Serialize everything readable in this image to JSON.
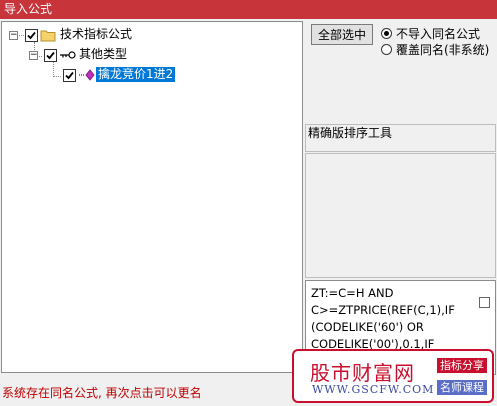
{
  "window": {
    "title": "导入公式"
  },
  "tree": {
    "root_label": "技术指标公式",
    "group_label": "其他类型",
    "item_label": "擒龙竞价1进2"
  },
  "options": {
    "select_all_label": "全部选中",
    "radio_skip_label": "不导入同名公式",
    "radio_overwrite_label": "覆盖同名(非系统)"
  },
  "description": {
    "title": "精确版排序工具"
  },
  "code": {
    "lines": [
      "ZT:=C=H AND",
      "C>=ZTPRICE(REF(C,1),IF",
      "(CODELIKE('60') OR",
      "CODELIKE('00'),0.1,IF"
    ]
  },
  "status": {
    "message": "系统存在同名公式, 再次点击可以更名"
  },
  "watermark": {
    "brand_cn": "股市财富网",
    "tag_share": "指标分享",
    "url": "WWW.GSCFW.COM",
    "tag_course": "名师课程"
  },
  "colors": {
    "titlebar": "#c7343a",
    "selection": "#0078d7",
    "status": "#c00000"
  }
}
